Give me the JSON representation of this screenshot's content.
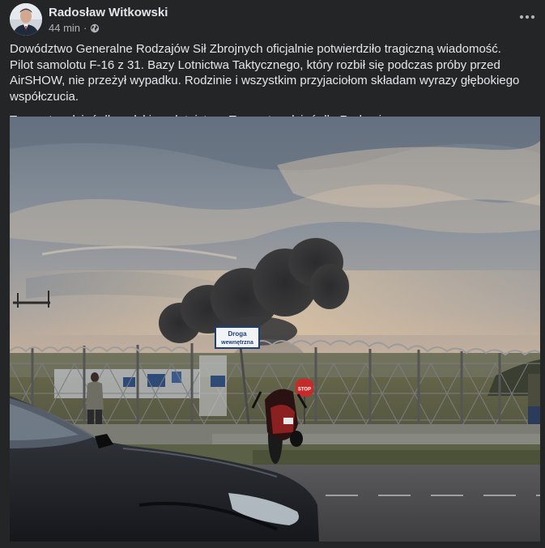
{
  "post": {
    "author": "Radosław Witkowski",
    "time": "44 min",
    "separator": "·",
    "privacy_icon": "globe-icon",
    "more_icon": "ellipsis-icon",
    "paragraphs": [
      "Dowództwo Generalne Rodzajów Sił Zbrojnych oficjalnie potwierdziło tragiczną wiadomość. Pilot samolotu F-16 z 31. Bazy Lotnictwa Taktycznego, który rozbił się podczas próby przed AirSHOW, nie przeżył wypadku. Rodzinie i wszystkim przyjaciołom składam wyrazy głębokiego współczucia.",
      "To smutny dzień dla polskiego lotnictwa. To smutny dzień dla Radomia."
    ]
  },
  "photo": {
    "sign_line1": "Droga",
    "sign_line2": "wewnętrzna",
    "stop_sign": "STOP"
  },
  "colors": {
    "background": "#242526",
    "text_primary": "#e4e6eb",
    "text_secondary": "#b0b3b8"
  }
}
